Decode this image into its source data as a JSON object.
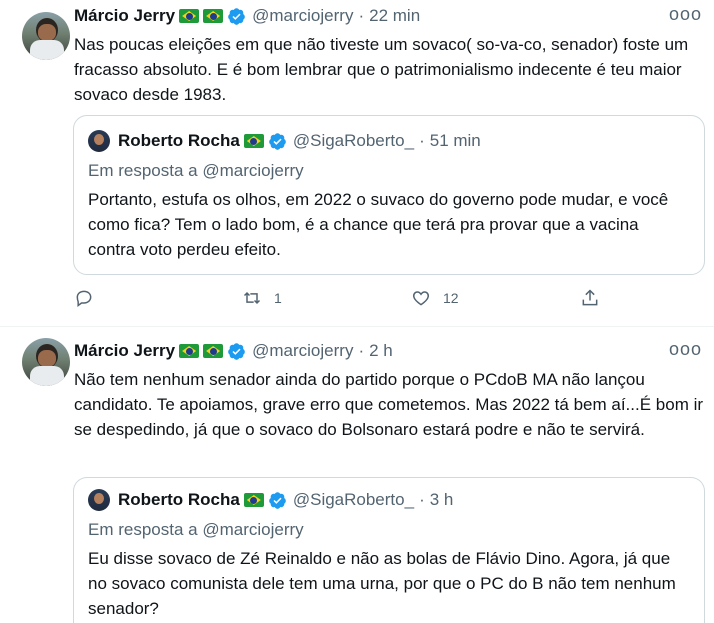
{
  "tweets": [
    {
      "author_name": "Márcio Jerry",
      "handle": "@marciojerry",
      "separator": "·",
      "time": "22 min",
      "more_label": "ooo",
      "text": "Nas poucas eleições em que não tiveste um sovaco( so-va-co, senador) foste um fracasso absoluto. E é bom lembrar que o patrimonialismo indecente é teu maior sovaco desde 1983.",
      "quote": {
        "author_name": "Roberto Rocha",
        "handle": "@SigaRoberto_",
        "separator": "·",
        "time": "51 min",
        "reply_to": "Em resposta a @marciojerry",
        "text": "Portanto, estufa os olhos, em 2022 o suvaco do governo pode mudar, e você como fica? Tem o lado bom, é a chance que terá pra provar que a vacina contra voto perdeu efeito."
      },
      "actions": {
        "reply_count": "",
        "retweet_count": "1",
        "like_count": "12"
      }
    },
    {
      "author_name": "Márcio Jerry",
      "handle": "@marciojerry",
      "separator": "·",
      "time": "2 h",
      "more_label": "ooo",
      "text": "Não tem nenhum senador ainda do partido porque o PCdoB MA não lançou candidato. Te apoiamos, grave erro que cometemos. Mas 2022 tá bem aí...É bom ir se despedindo, já que o sovaco do Bolsonaro estará podre e não te servirá.",
      "quote": {
        "author_name": "Roberto Rocha",
        "handle": "@SigaRoberto_",
        "separator": "·",
        "time": "3 h",
        "reply_to": "Em resposta a @marciojerry",
        "text": "Eu disse sovaco de Zé Reinaldo e não as bolas de Flávio Dino. Agora, já que no sovaco comunista dele tem uma urna, por que o PC do B não tem nenhum senador?"
      }
    }
  ],
  "colors": {
    "text": "#0f1419",
    "secondary": "#536471",
    "verified": "#1d9bf0",
    "border": "#cfd9de"
  },
  "icons": [
    "verified-badge-icon",
    "flag-brazil-icon",
    "more-icon",
    "reply-icon",
    "retweet-icon",
    "like-icon",
    "share-icon"
  ]
}
